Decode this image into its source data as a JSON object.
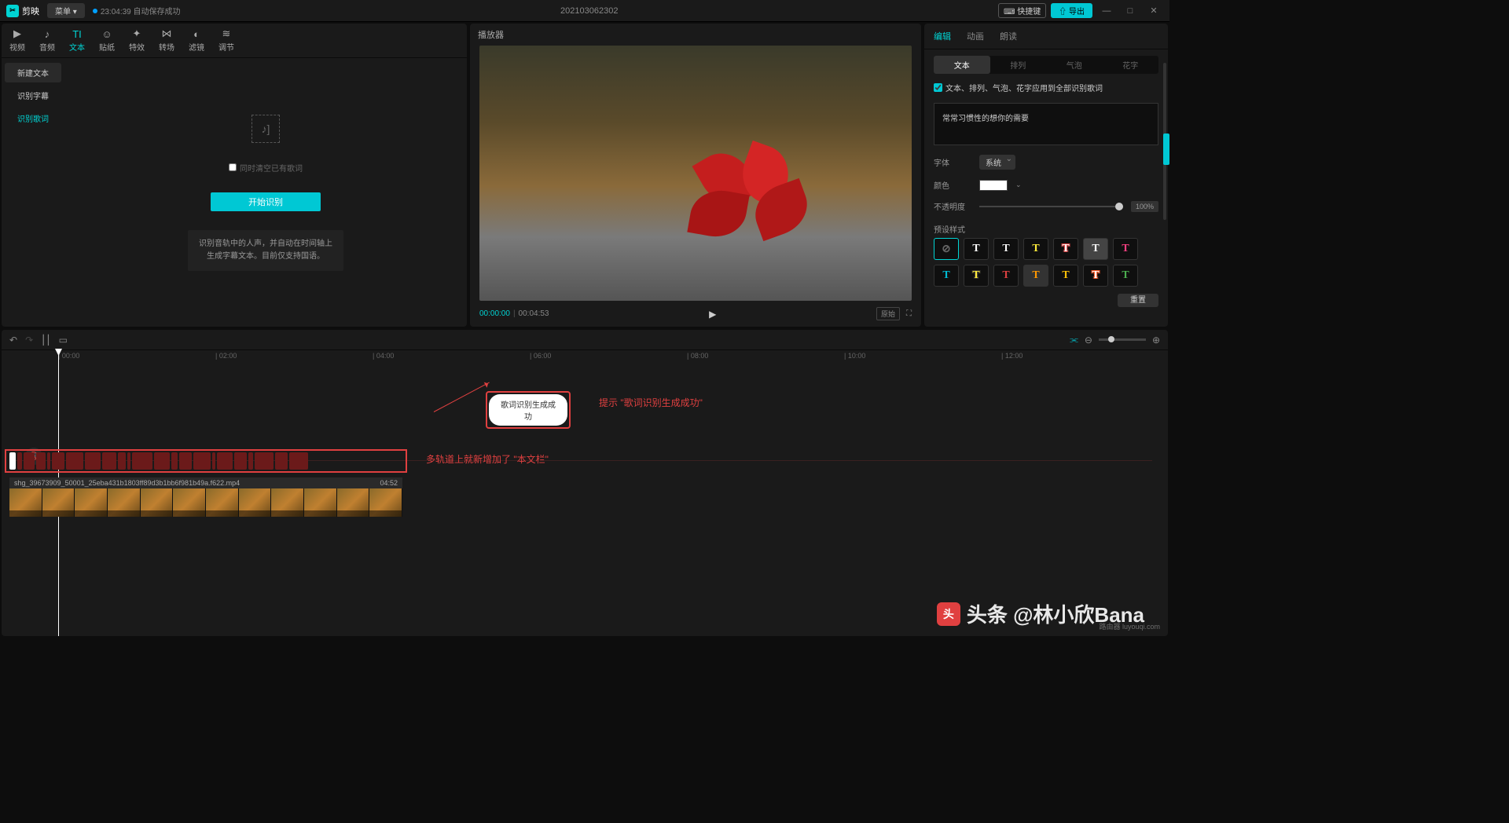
{
  "titlebar": {
    "app_name": "剪映",
    "menu": "菜单 ▾",
    "save_time": "23:04:39",
    "save_status": "自动保存成功",
    "project_name": "202103062302",
    "shortcut": "⌨ 快捷键",
    "export": "⇧ 导出"
  },
  "media_tabs": [
    {
      "icon": "▶",
      "label": "视频"
    },
    {
      "icon": "♪",
      "label": "音频"
    },
    {
      "icon": "TI",
      "label": "文本"
    },
    {
      "icon": "☺",
      "label": "贴纸"
    },
    {
      "icon": "✦",
      "label": "特效"
    },
    {
      "icon": "⋈",
      "label": "转场"
    },
    {
      "icon": "◐",
      "label": "滤镜"
    },
    {
      "icon": "≋",
      "label": "调节"
    }
  ],
  "left_sidebar": [
    {
      "label": "新建文本",
      "style": "box"
    },
    {
      "label": "识别字幕",
      "style": "plain"
    },
    {
      "label": "识别歌词",
      "style": "active"
    }
  ],
  "left_content": {
    "checkbox": "同时清空已有歌词",
    "start_btn": "开始识别",
    "desc1": "识别音轨中的人声，并自动在时间轴上",
    "desc2": "生成字幕文本。目前仅支持国语。"
  },
  "preview": {
    "header": "播放器",
    "time_cur": "00:00:00",
    "time_total": "00:04:53",
    "ratio": "原始"
  },
  "right": {
    "tabs": [
      "编辑",
      "动画",
      "朗读"
    ],
    "subtabs": [
      "文本",
      "排列",
      "气泡",
      "花字"
    ],
    "apply_all": "文本、排列、气泡、花字应用到全部识别歌词",
    "text_content": "常常习惯性的想你的需要",
    "font_label": "字体",
    "font_value": "系统",
    "color_label": "颜色",
    "opacity_label": "不透明度",
    "opacity_value": "100%",
    "preset_label": "预设样式",
    "reset": "重置"
  },
  "preset_styles": [
    {
      "t": "⊘",
      "c": "#666"
    },
    {
      "t": "T",
      "c": "#fff"
    },
    {
      "t": "T",
      "c": "#fff",
      "o": "#000"
    },
    {
      "t": "T",
      "c": "#ffeb3b"
    },
    {
      "t": "T",
      "c": "#fff",
      "o": "#e04040"
    },
    {
      "t": "T",
      "c": "#fff",
      "bg": "#444"
    },
    {
      "t": "T",
      "c": "#ff4081"
    },
    {
      "t": "T",
      "c": "#00bcd4"
    },
    {
      "t": "T",
      "c": "#ffeb3b",
      "o": "#333"
    },
    {
      "t": "T",
      "c": "#e04040"
    },
    {
      "t": "T",
      "c": "#ff9800",
      "bg": "#333"
    },
    {
      "t": "T",
      "c": "#ffc107"
    },
    {
      "t": "T",
      "c": "#fff",
      "o": "#ff5722"
    },
    {
      "t": "T",
      "c": "#4caf50"
    }
  ],
  "timeline": {
    "ticks": [
      "00:00",
      "02:00",
      "04:00",
      "06:00",
      "08:00",
      "10:00",
      "12:00"
    ],
    "toast": "歌词识别生成成功",
    "annot1": "提示 \"歌词识别生成成功\"",
    "annot2": "多轨道上就新增加了 \"本文栏\"",
    "video_name": "shg_39673909_50001_25eba431b1803ff89d3b1bb6f981b49a.f622.mp4",
    "video_dur": "04:52"
  },
  "watermark": "头条 @林小欣Bana",
  "watermark_small": "路由器 luyouqi.com"
}
